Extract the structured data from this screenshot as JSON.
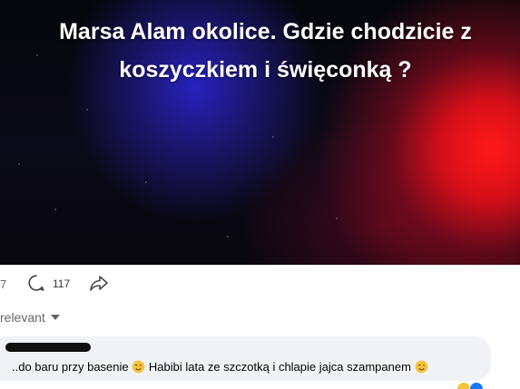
{
  "post": {
    "overlay_line1": "Marsa Alam okolice. Gdzie chodzicie z",
    "overlay_line2": "koszyczkiem i święconką ?"
  },
  "actions": {
    "reactions_count": "7",
    "comments_count": "117",
    "icons": [
      "comment-icon",
      "share-icon"
    ]
  },
  "sort": {
    "label": "relevant"
  },
  "comment": {
    "text_part1": "..do baru przy basenie",
    "text_part2": " Habibi lata ze szczotką i chlapie jajca szampanem",
    "emoji": "winking-face"
  },
  "colors": {
    "comment_bg": "#f0f2f5",
    "meta_text": "#65676b",
    "like_blue": "#1877f2"
  }
}
